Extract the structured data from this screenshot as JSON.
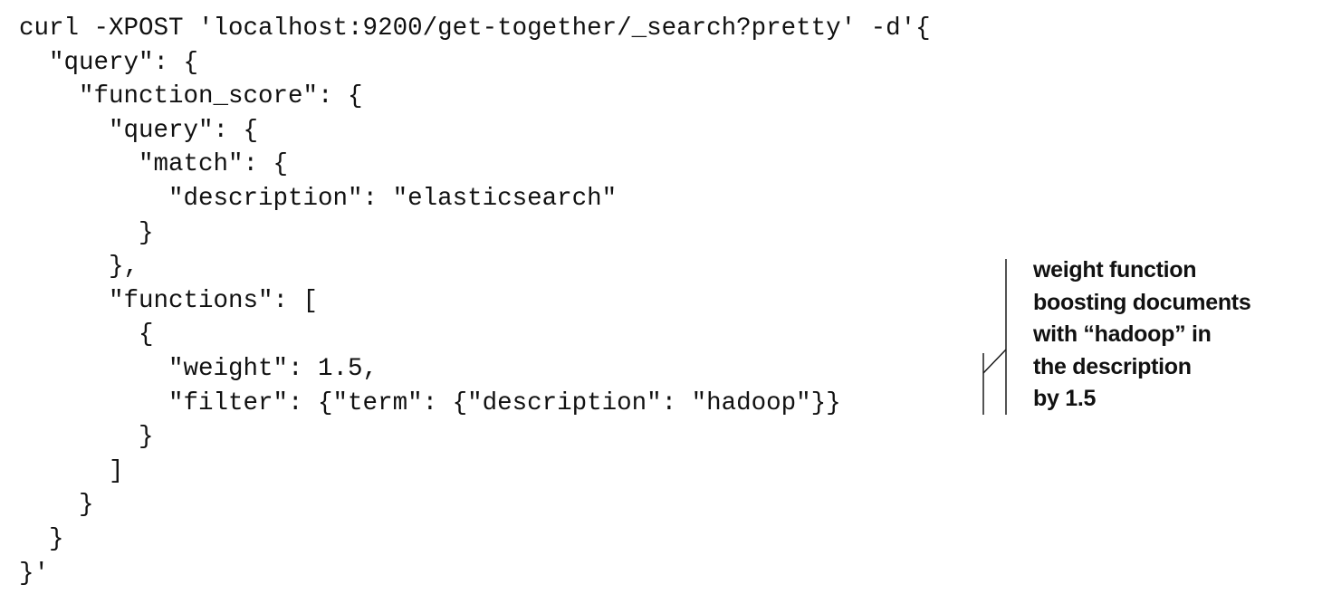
{
  "code": {
    "lines": [
      "curl -XPOST 'localhost:9200/get-together/_search?pretty' -d'{",
      "  \"query\": {",
      "    \"function_score\": {",
      "      \"query\": {",
      "        \"match\": {",
      "          \"description\": \"elasticsearch\"",
      "        }",
      "      },",
      "      \"functions\": [",
      "        {",
      "          \"weight\": 1.5,",
      "          \"filter\": {\"term\": {\"description\": \"hadoop\"}}",
      "        }",
      "      ]",
      "    }",
      "  }",
      "}'"
    ]
  },
  "annotation": {
    "lines": [
      "weight function",
      "boosting documents",
      "with “hadoop” in",
      "the description",
      "by 1.5"
    ]
  }
}
